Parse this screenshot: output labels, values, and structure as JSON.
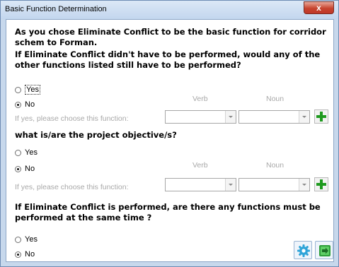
{
  "window": {
    "title": "Basic Function Determination",
    "close_glyph": "x"
  },
  "intro": {
    "text": "As you chose Eliminate Conflict to be the basic function for corridor schem to Forman."
  },
  "q1": {
    "question": "If Eliminate Conflict didn't have to be performed, would any of the other functions listed still have to be performed?",
    "yes_label": "Yes",
    "no_label": "No",
    "selected": "No",
    "verb_header": "Verb",
    "noun_header": "Noun",
    "choose_hint": "If yes, please choose this function:",
    "verb_value": "",
    "noun_value": "",
    "add_icon": "green-plus-icon"
  },
  "q2": {
    "question": "what is/are the project objective/s?",
    "yes_label": "Yes",
    "no_label": "No",
    "selected": "No",
    "verb_header": "Verb",
    "noun_header": "Noun",
    "choose_hint": "If yes, please choose this function:",
    "verb_value": "",
    "noun_value": "",
    "add_icon": "green-plus-icon"
  },
  "q3": {
    "question": "If Eliminate Conflict is performed, are there any functions must be performed at the same time ?",
    "yes_label": "Yes",
    "no_label": "No",
    "selected": "No"
  },
  "footer": {
    "settings_icon": "gear-icon",
    "next_icon": "next-arrow-icon"
  },
  "colors": {
    "frame": "#c7d8ec",
    "close_button": "#c7442e",
    "hint_gray": "#a8a8a8",
    "plus_green": "#1f9a1f"
  }
}
